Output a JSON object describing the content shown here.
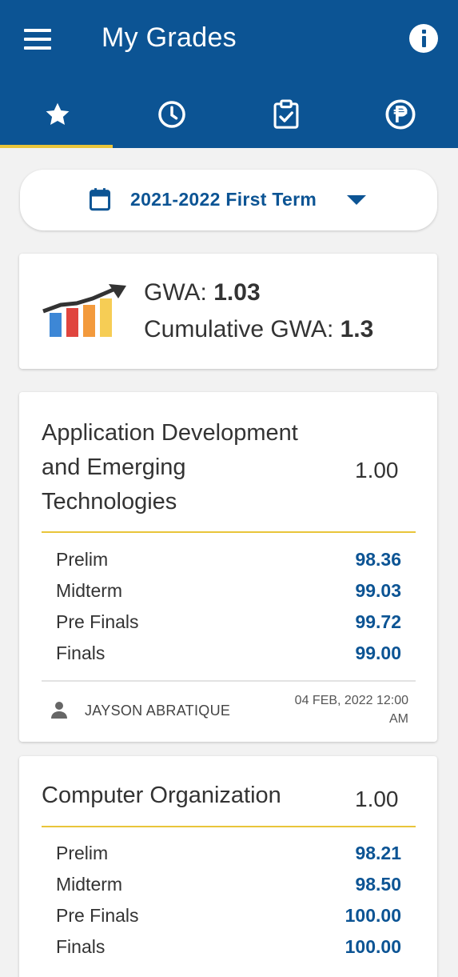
{
  "header": {
    "title": "My Grades",
    "tabs": [
      {
        "icon": "star-icon",
        "active": true
      },
      {
        "icon": "clock-icon",
        "active": false
      },
      {
        "icon": "clipboard-check-icon",
        "active": false
      },
      {
        "icon": "peso-icon",
        "active": false
      }
    ]
  },
  "term": {
    "label": "2021-2022 First Term"
  },
  "summary": {
    "gwa_label": "GWA:",
    "gwa_value": "1.03",
    "cumulative_label": "Cumulative GWA:",
    "cumulative_value": "1.3"
  },
  "subjects": [
    {
      "title_lines": [
        "Application Development",
        "and Emerging",
        "Technologies"
      ],
      "grade": "1.00",
      "periods": [
        {
          "label": "Prelim",
          "value": "98.36"
        },
        {
          "label": "Midterm",
          "value": "99.03"
        },
        {
          "label": "Pre Finals",
          "value": "99.72"
        },
        {
          "label": "Finals",
          "value": "99.00"
        }
      ],
      "teacher": "JAYSON ABRATIQUE",
      "date_line1": "04 FEB, 2022 12:00",
      "date_line2": "AM"
    },
    {
      "title_lines": [
        "Computer Organization"
      ],
      "grade": "1.00",
      "periods": [
        {
          "label": "Prelim",
          "value": "98.21"
        },
        {
          "label": "Midterm",
          "value": "98.50"
        },
        {
          "label": "Pre Finals",
          "value": "100.00"
        },
        {
          "label": "Finals",
          "value": "100.00"
        }
      ]
    }
  ],
  "colors": {
    "primary": "#0c5494",
    "accent": "#e9c53a",
    "background": "#f2f2f2"
  }
}
